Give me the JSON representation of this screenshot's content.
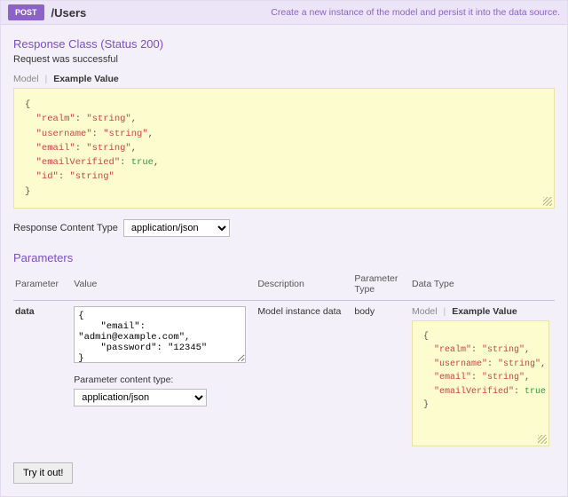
{
  "head": {
    "method": "POST",
    "path": "/Users",
    "summary": "Create a new instance of the model and persist it into the data source."
  },
  "response": {
    "title": "Response Class (Status 200)",
    "subtitle": "Request was successful",
    "tabs": {
      "model": "Model",
      "example": "Example Value"
    },
    "example_lines": [
      {
        "t": "{"
      },
      {
        "t": "  ",
        "k": "\"realm\"",
        "c": ": ",
        "s": "\"string\"",
        "e": ","
      },
      {
        "t": "  ",
        "k": "\"username\"",
        "c": ": ",
        "s": "\"string\"",
        "e": ","
      },
      {
        "t": "  ",
        "k": "\"email\"",
        "c": ": ",
        "s": "\"string\"",
        "e": ","
      },
      {
        "t": "  ",
        "k": "\"emailVerified\"",
        "c": ": ",
        "b": "true",
        "e": ","
      },
      {
        "t": "  ",
        "k": "\"id\"",
        "c": ": ",
        "s": "\"string\"",
        "e": ""
      },
      {
        "t": "}"
      }
    ]
  },
  "content_type": {
    "label": "Response Content Type",
    "value": "application/json"
  },
  "parameters": {
    "title": "Parameters",
    "cols": {
      "parameter": "Parameter",
      "value": "Value",
      "description": "Description",
      "ptype": "Parameter Type",
      "dtype": "Data Type"
    },
    "row": {
      "name": "data",
      "value": "{\n    \"email\": \"admin@example.com\",\n    \"password\": \"12345\"\n}",
      "description": "Model instance data",
      "ptype": "body",
      "pct_label": "Parameter content type:",
      "pct_value": "application/json",
      "dtype_tabs": {
        "model": "Model",
        "example": "Example Value"
      },
      "dtype_lines": [
        {
          "t": "{"
        },
        {
          "t": "  ",
          "k": "\"realm\"",
          "c": ": ",
          "s": "\"string\"",
          "e": ","
        },
        {
          "t": "  ",
          "k": "\"username\"",
          "c": ": ",
          "s": "\"string\"",
          "e": ","
        },
        {
          "t": "  ",
          "k": "\"email\"",
          "c": ": ",
          "s": "\"string\"",
          "e": ","
        },
        {
          "t": "  ",
          "k": "\"emailVerified\"",
          "c": ": ",
          "b": "true",
          "e": ""
        },
        {
          "t": "}"
        }
      ]
    }
  },
  "tryit": {
    "label": "Try it out!"
  }
}
